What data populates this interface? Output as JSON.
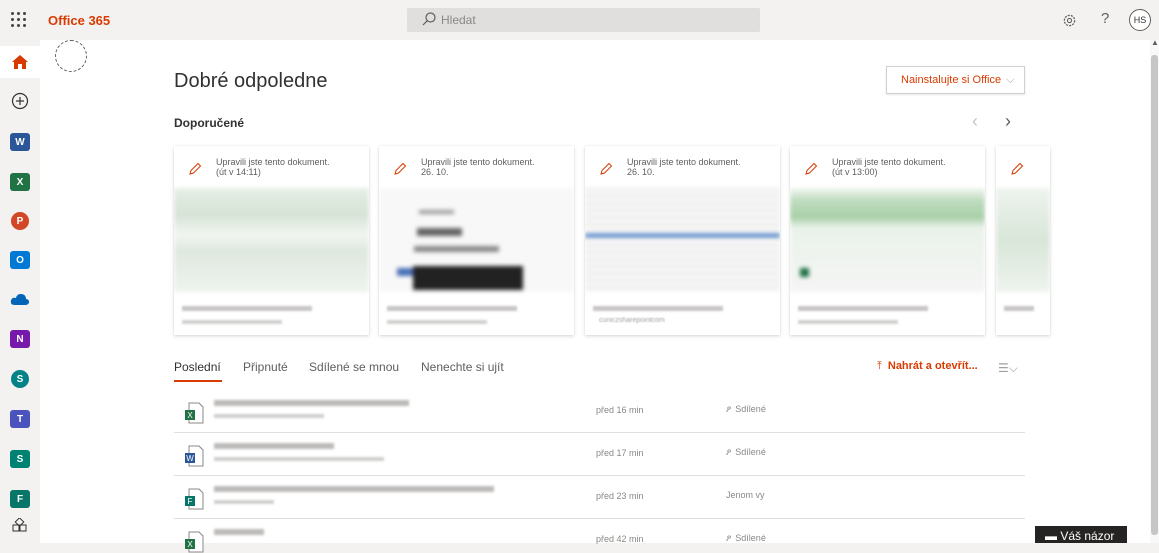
{
  "header": {
    "app_name": "Office 365",
    "search_placeholder": "Hledat",
    "help": "?",
    "avatar_initials": "HS"
  },
  "rail": {
    "apps": [
      {
        "name": "home",
        "label": ""
      },
      {
        "name": "create",
        "label": ""
      },
      {
        "name": "word",
        "label": "W",
        "color": "#2b579a"
      },
      {
        "name": "excel",
        "label": "X",
        "color": "#217346"
      },
      {
        "name": "powerpoint",
        "label": "P",
        "color": "#d24726"
      },
      {
        "name": "outlook",
        "label": "O",
        "color": "#0078d4"
      },
      {
        "name": "onedrive",
        "label": "",
        "color": "#0364b8"
      },
      {
        "name": "onenote",
        "label": "N",
        "color": "#7719aa"
      },
      {
        "name": "sharepoint",
        "label": "S",
        "color": "#038387"
      },
      {
        "name": "teams",
        "label": "T",
        "color": "#4b53bc"
      },
      {
        "name": "sway",
        "label": "S",
        "color": "#008272"
      },
      {
        "name": "forms",
        "label": "F",
        "color": "#077568"
      },
      {
        "name": "all-apps",
        "label": ""
      }
    ]
  },
  "main": {
    "greeting": "Dobré odpoledne",
    "install_button": "Nainstalujte si Office",
    "recommended_title": "Doporučené",
    "cards": [
      {
        "line1": "Upravili jste tento dokument.",
        "line2": "(út v 14:11)",
        "footer_url": ""
      },
      {
        "line1": "Upravili jste tento dokument.",
        "line2": "26. 10.",
        "footer_url": ""
      },
      {
        "line1": "Upravili jste tento dokument.",
        "line2": "26. 10.",
        "footer_url": "cuniczsharepointcom"
      },
      {
        "line1": "Upravili jste tento dokument.",
        "line2": "(út v 13:00)",
        "footer_url": ""
      }
    ],
    "tabs": [
      "Poslední",
      "Připnuté",
      "Sdílené se mnou",
      "Nenechte si ujít"
    ],
    "upload_label": "Nahrát a otevřít...",
    "files": [
      {
        "type": "excel",
        "time": "před 16 min",
        "sharing": "Sdílené"
      },
      {
        "type": "word",
        "time": "před 17 min",
        "sharing": "Sdílené"
      },
      {
        "type": "forms",
        "time": "před 23 min",
        "sharing": "Jenom vy"
      },
      {
        "type": "excel",
        "time": "před 42 min",
        "sharing": "Sdílené"
      }
    ]
  },
  "feedback_label": "Váš názor",
  "colors": {
    "accent": "#d83b01",
    "excel": "#217346",
    "word": "#2b579a",
    "forms": "#077568"
  }
}
